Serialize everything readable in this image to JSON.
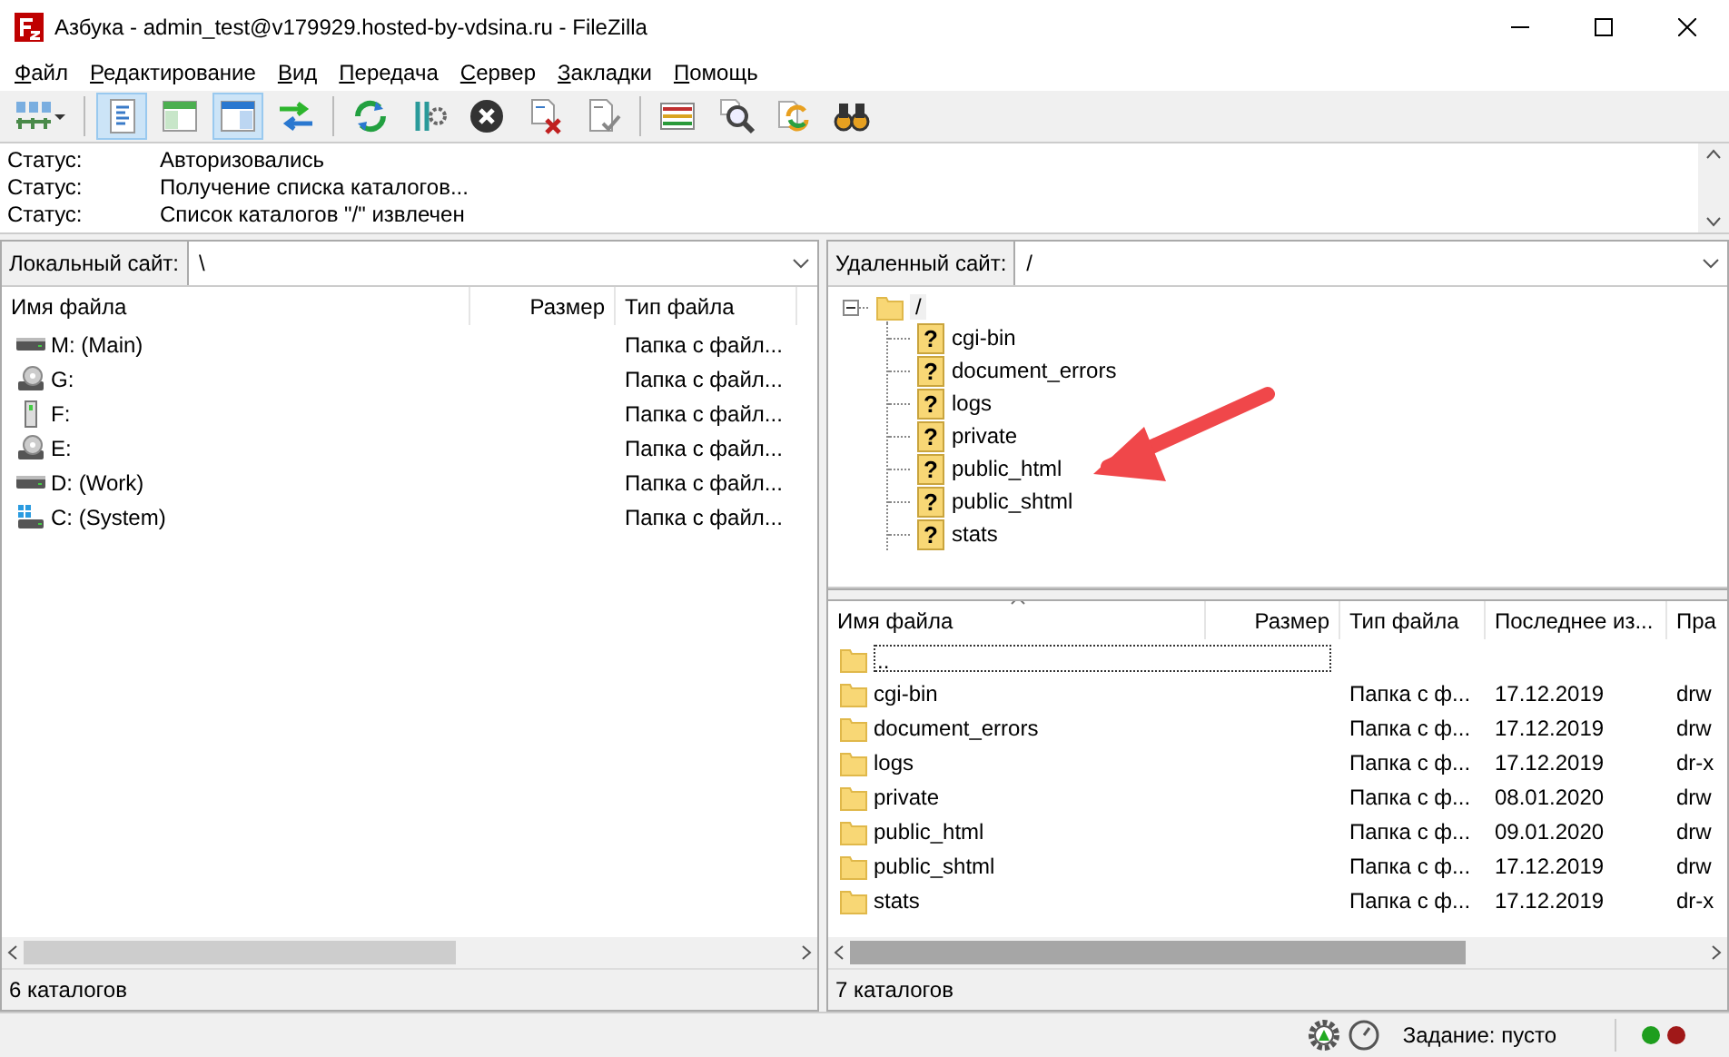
{
  "window": {
    "title": "Азбука - admin_test@v179929.hosted-by-vdsina.ru - FileZilla"
  },
  "menu": [
    {
      "label": "Файл"
    },
    {
      "label": "Редактирование"
    },
    {
      "label": "Вид"
    },
    {
      "label": "Передача"
    },
    {
      "label": "Сервер"
    },
    {
      "label": "Закладки"
    },
    {
      "label": "Помощь"
    }
  ],
  "toolbar": [
    {
      "kind": "sitemanager",
      "pressed": false
    },
    {
      "kind": "separator"
    },
    {
      "kind": "log",
      "pressed": true
    },
    {
      "kind": "localtree",
      "pressed": false
    },
    {
      "kind": "remotetree",
      "pressed": true
    },
    {
      "kind": "queue",
      "pressed": false
    },
    {
      "kind": "separator"
    },
    {
      "kind": "refresh",
      "pressed": false
    },
    {
      "kind": "filters",
      "pressed": false
    },
    {
      "kind": "cancel",
      "pressed": false
    },
    {
      "kind": "disconnect",
      "pressed": false
    },
    {
      "kind": "reconnect",
      "pressed": false
    },
    {
      "kind": "separator"
    },
    {
      "kind": "compare",
      "pressed": false
    },
    {
      "kind": "search",
      "pressed": false
    },
    {
      "kind": "sync",
      "pressed": false
    },
    {
      "kind": "find",
      "pressed": false
    }
  ],
  "log": [
    {
      "label": "Статус:",
      "message": "Авторизовались"
    },
    {
      "label": "Статус:",
      "message": "Получение списка каталогов..."
    },
    {
      "label": "Статус:",
      "message": "Список каталогов \"/\" извлечен"
    }
  ],
  "local": {
    "site_label": "Локальный сайт:",
    "path": "\\",
    "columns": [
      "Имя файла",
      "Размер",
      "Тип файла"
    ],
    "rows": [
      {
        "kind": "hdd",
        "name": "M: (Main)",
        "type": "Папка с файл..."
      },
      {
        "kind": "cdrom",
        "name": "G:",
        "type": "Папка с файл..."
      },
      {
        "kind": "usb",
        "name": "F:",
        "type": "Папка с файл..."
      },
      {
        "kind": "cdrom",
        "name": "E:",
        "type": "Папка с файл..."
      },
      {
        "kind": "hdd",
        "name": "D: (Work)",
        "type": "Папка с файл..."
      },
      {
        "kind": "system",
        "name": "C: (System)",
        "type": "Папка с файл..."
      }
    ],
    "status": "6 каталогов"
  },
  "remote": {
    "site_label": "Удаленный сайт:",
    "path": "/",
    "tree": [
      {
        "name": "/",
        "expanded": true,
        "children": [
          {
            "name": "cgi-bin",
            "icon": "?"
          },
          {
            "name": "document_errors",
            "icon": "?"
          },
          {
            "name": "logs",
            "icon": "?"
          },
          {
            "name": "private",
            "icon": "?"
          },
          {
            "name": "public_html",
            "icon": "?"
          },
          {
            "name": "public_shtml",
            "icon": "?"
          },
          {
            "name": "stats",
            "icon": "?"
          }
        ]
      }
    ],
    "columns": [
      "Имя файла",
      "Размер",
      "Тип файла",
      "Последнее из...",
      "Пра"
    ],
    "rows": [
      {
        "name": "..",
        "focused": true
      },
      {
        "name": "cgi-bin",
        "type": "Папка с ф...",
        "modified": "17.12.2019",
        "permissions": "drw",
        "focused": false
      },
      {
        "name": "document_errors",
        "type": "Папка с ф...",
        "modified": "17.12.2019",
        "permissions": "drw",
        "focused": false
      },
      {
        "name": "logs",
        "type": "Папка с ф...",
        "modified": "17.12.2019",
        "permissions": "dr-x",
        "focused": false
      },
      {
        "name": "private",
        "type": "Папка с ф...",
        "modified": "08.01.2020",
        "permissions": "drw",
        "focused": false
      },
      {
        "name": "public_html",
        "type": "Папка с ф...",
        "modified": "09.01.2020",
        "permissions": "drw",
        "focused": false
      },
      {
        "name": "public_shtml",
        "type": "Папка с ф...",
        "modified": "17.12.2019",
        "permissions": "drw",
        "focused": false
      },
      {
        "name": "stats",
        "type": "Папка с ф...",
        "modified": "17.12.2019",
        "permissions": "dr-x",
        "focused": false
      }
    ],
    "status": "7 каталогов"
  },
  "statusbar": {
    "queue": "Задание: пусто",
    "lights": [
      {
        "color": "#1e9e1e"
      },
      {
        "color": "#a01818"
      }
    ]
  },
  "annotation": {
    "kind": "arrow"
  }
}
